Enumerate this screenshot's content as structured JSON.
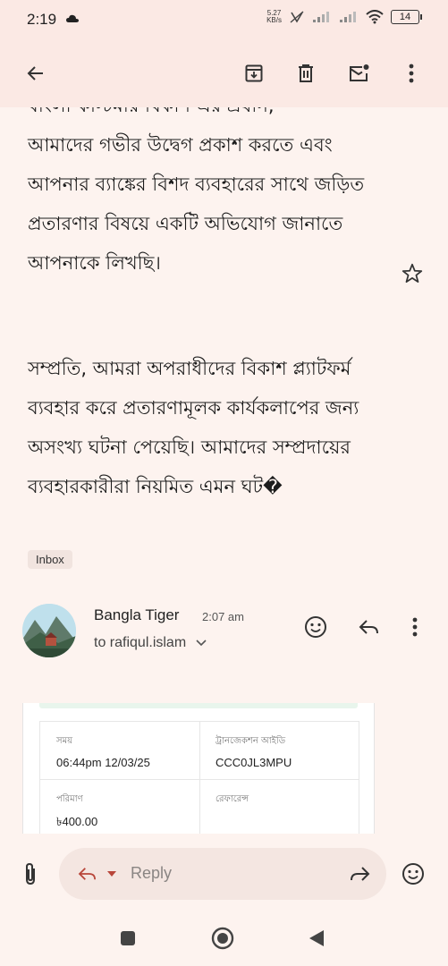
{
  "status": {
    "time": "2:19",
    "net_speed_top": "5.27",
    "net_speed_bottom": "KB/s",
    "battery": "14"
  },
  "toolbar": {
    "back": "arrow-back-icon",
    "archive": "archive-icon",
    "delete": "delete-icon",
    "mark_unread": "mark-unread-icon",
    "more": "more-vert-icon"
  },
  "email": {
    "cut_line": "বাংলা কাস্টমার বিকাশ এর প্রধান,",
    "para1": "আমাদের গভীর উদ্বেগ প্রকাশ করতে এবং আপনার ব্যাঙ্কের বিশদ ব্যবহারের সাথে জড়িত প্রতারণার বিষয়ে একটি অভিযোগ জানাতে আপনাকে লিখছি।",
    "para2": "সম্প্রতি, আমরা অপরাধীদের বিকাশ প্ল্যাটফর্ম ব্যবহার করে প্রতারণামূলক কার্যকলাপের জন্য অসংখ্য ঘটনা পেয়েছি। আমাদের সম্প্রদায়ের ব্যবহারকারীরা নিয়মিত এমন ঘট�",
    "label": "Inbox"
  },
  "message": {
    "sender": "Bangla Tiger",
    "time": "2:07 am",
    "recipient": "to rafiqul.islam",
    "receipt": {
      "time_label": "সময়",
      "time_value": "06:44pm 12/03/25",
      "txid_label": "ট্রানজেকশন আইডি",
      "txid_value": "CCC0JL3MPU",
      "amount_label": "পরিমাণ",
      "amount_value": "৳400.00",
      "reference_label": "রেফারেন্স"
    }
  },
  "reply": {
    "placeholder": "Reply"
  },
  "colors": {
    "background": "#fdf3ef",
    "header": "#fbe9e4",
    "reply_bar": "#f4e6e1"
  }
}
